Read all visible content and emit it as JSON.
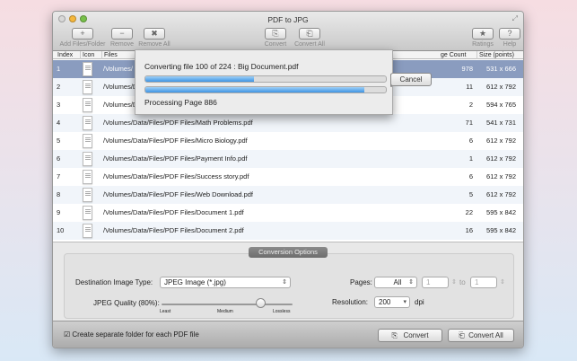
{
  "window": {
    "title": "PDF to JPG"
  },
  "toolbar": [
    {
      "label": "Add Files/Folder",
      "icon": "+"
    },
    {
      "label": "Remove",
      "icon": "−"
    },
    {
      "label": "Remove All",
      "icon": "✖"
    },
    {
      "label": "Convert",
      "icon": "⎘"
    },
    {
      "label": "Convert All",
      "icon": "⎗"
    },
    {
      "label": "Ratings",
      "icon": "★"
    },
    {
      "label": "Help",
      "icon": "?"
    }
  ],
  "table": {
    "headers": {
      "index": "Index",
      "icon": "Icon",
      "files": "Files",
      "count": "ge Count",
      "size": "Size (points)"
    },
    "rows": [
      {
        "index": "1",
        "file": "/Volumes/",
        "count": "978",
        "size": "531 x 666"
      },
      {
        "index": "2",
        "file": "/Volumes/D",
        "count": "11",
        "size": "612 x 792"
      },
      {
        "index": "3",
        "file": "/Volumes/D",
        "count": "2",
        "size": "594 x 765"
      },
      {
        "index": "4",
        "file": "/Volumes/Data/Files/PDF Files/Math Problems.pdf",
        "count": "71",
        "size": "541 x 731"
      },
      {
        "index": "5",
        "file": "/Volumes/Data/Files/PDF Files/Micro Biology.pdf",
        "count": "6",
        "size": "612 x 792"
      },
      {
        "index": "6",
        "file": "/Volumes/Data/Files/PDF Files/Payment Info.pdf",
        "count": "1",
        "size": "612 x 792"
      },
      {
        "index": "7",
        "file": "/Volumes/Data/Files/PDF Files/Success story.pdf",
        "count": "6",
        "size": "612 x 792"
      },
      {
        "index": "8",
        "file": "/Volumes/Data/Files/PDF Files/Web Download.pdf",
        "count": "5",
        "size": "612 x 792"
      },
      {
        "index": "9",
        "file": "/Volumes/Data/Files/PDF Files/Document 1.pdf",
        "count": "22",
        "size": "595 x 842"
      },
      {
        "index": "10",
        "file": "/Volumes/Data/Files/PDF Files/Document 2.pdf",
        "count": "16",
        "size": "595 x 842"
      }
    ]
  },
  "dialog": {
    "status": "Converting file 100 of 224 : Big Document.pdf",
    "cancel": "Cancel",
    "page_status": "Processing Page 886",
    "file_progress": 0.45,
    "page_progress": 0.91
  },
  "options": {
    "title": "Conversion Options",
    "dest_label": "Destination Image Type:",
    "dest_value": "JPEG Image (*.jpg)",
    "quality_label": "JPEG Quality (80%):",
    "quality": 0.8,
    "ticks": [
      "Least",
      "Medium",
      "Lossless"
    ],
    "pages_label": "Pages:",
    "pages_value": "All",
    "from": "1",
    "to_label": "to",
    "to": "1",
    "res_label": "Resolution:",
    "res_value": "200",
    "res_unit": "dpi"
  },
  "bottom": {
    "checkbox_label": "Create separate folder for each PDF file",
    "checked": true,
    "convert": "Convert",
    "convert_all": "Convert All"
  }
}
